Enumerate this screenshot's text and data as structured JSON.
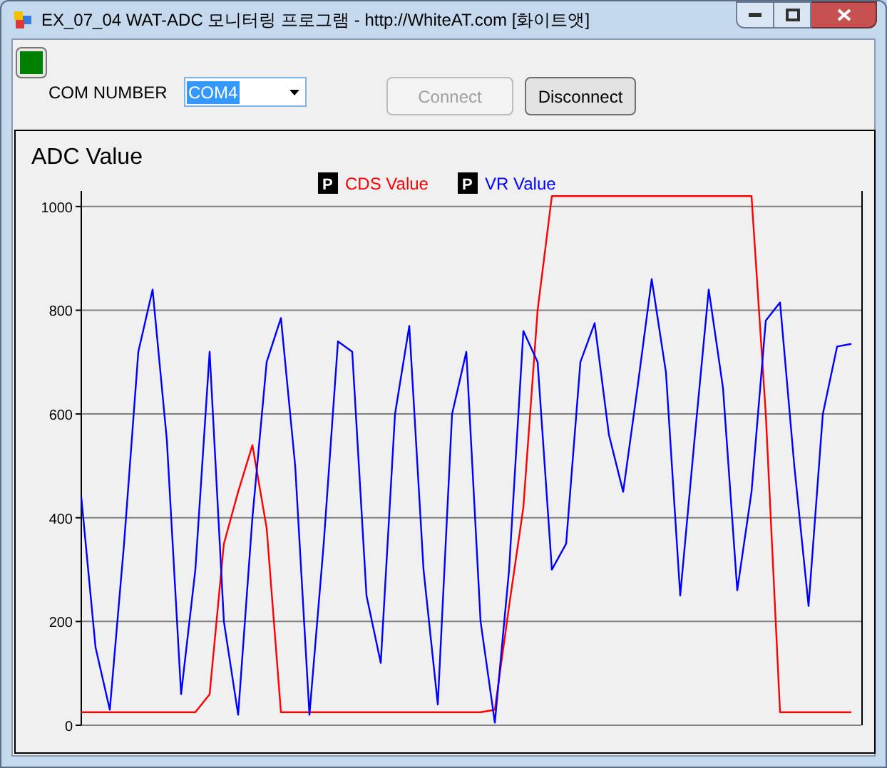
{
  "window": {
    "title": "EX_07_04 WAT-ADC 모니터링 프로그램 - http://WhiteAT.com [화이트앳]"
  },
  "connected": true,
  "com_number": {
    "label": "COM NUMBER",
    "value": "COM4"
  },
  "buttons": [
    {
      "label": "Connect",
      "disabled": true
    },
    {
      "label": "Disconnect",
      "disabled": false
    }
  ],
  "chart": {
    "legend_markers": [
      "P",
      "P"
    ],
    "chart_data": {
      "type": "line",
      "title": "ADC Value",
      "categories": [
        null,
        null,
        null,
        null,
        null,
        null,
        null,
        null,
        null,
        null,
        null,
        null,
        null,
        null,
        null,
        null,
        null,
        null,
        null,
        null,
        null,
        null,
        null,
        null,
        null,
        null,
        null,
        null,
        null,
        null,
        null,
        null,
        null,
        null,
        null,
        null,
        null,
        null,
        null,
        null,
        null,
        null,
        null,
        null,
        null,
        null,
        null,
        null,
        null,
        null,
        null,
        null,
        null,
        null,
        null
      ],
      "series": [
        {
          "name": "CDS Value",
          "color": "#ff0000",
          "values": [
            25,
            25,
            25,
            25,
            25,
            25,
            25,
            25,
            25,
            60,
            350,
            450,
            540,
            380,
            25,
            25,
            25,
            25,
            25,
            25,
            25,
            25,
            25,
            25,
            25,
            25,
            25,
            25,
            25,
            30,
            230,
            420,
            800,
            1020,
            1020,
            1020,
            1020,
            1020,
            1020,
            1020,
            1020,
            1020,
            1020,
            1020,
            1020,
            1020,
            1020,
            1020,
            600,
            25,
            25,
            25,
            25,
            25,
            25
          ]
        },
        {
          "name": "VR Value",
          "color": "#0000ff",
          "values": [
            440,
            150,
            30,
            350,
            720,
            840,
            550,
            60,
            300,
            720,
            200,
            20,
            400,
            700,
            785,
            500,
            20,
            350,
            740,
            720,
            250,
            120,
            600,
            770,
            300,
            40,
            600,
            720,
            200,
            5,
            300,
            760,
            700,
            300,
            350,
            700,
            775,
            560,
            450,
            650,
            860,
            680,
            250,
            550,
            840,
            650,
            260,
            450,
            780,
            815,
            500,
            230,
            600,
            730,
            735
          ]
        }
      ],
      "grid": true,
      "ylim": [
        0,
        1030
      ],
      "yticks": [
        0,
        200,
        400,
        600,
        800,
        1000
      ]
    }
  }
}
